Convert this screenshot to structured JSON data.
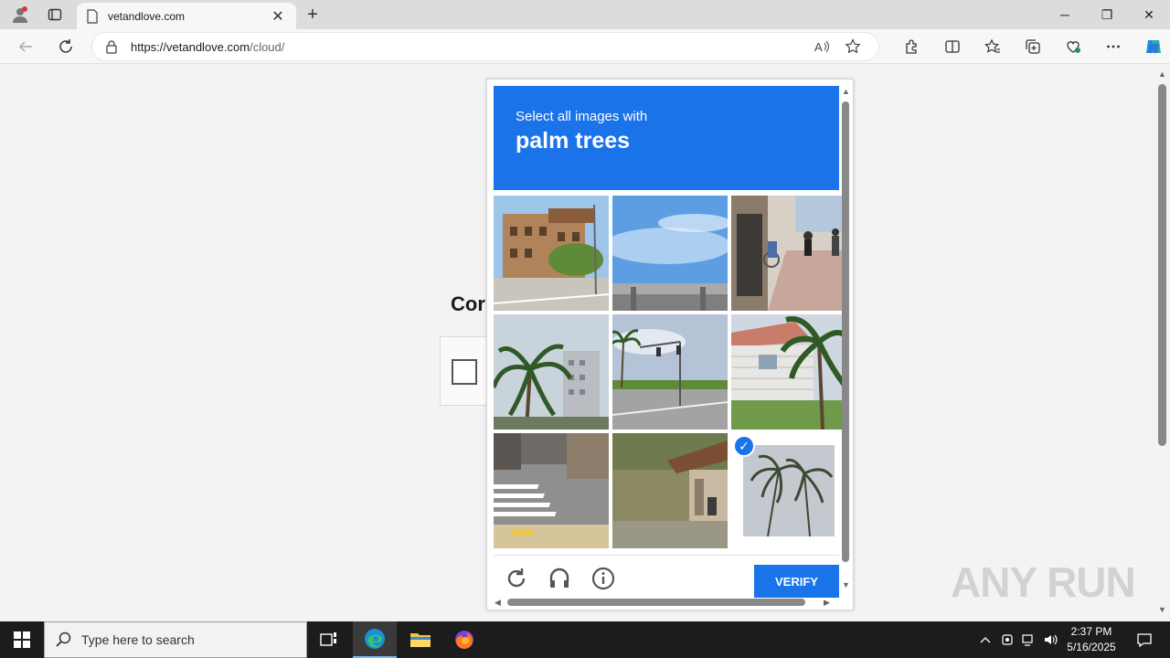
{
  "browser": {
    "tab_title": "vetandlove.com",
    "url_host": "https://vetandlove.com",
    "url_path": "/cloud/"
  },
  "page": {
    "heading_partial": "Cor"
  },
  "challenge": {
    "prompt_line1": "Select all images with",
    "prompt_line2": "palm trees",
    "verify_label": "VERIFY",
    "selected_tiles": [
      8
    ],
    "tiles": [
      {
        "name": "tile-building-street"
      },
      {
        "name": "tile-sky-bridge"
      },
      {
        "name": "tile-sidewalk-cyclists"
      },
      {
        "name": "tile-palm-building"
      },
      {
        "name": "tile-intersection-palms"
      },
      {
        "name": "tile-house-palm"
      },
      {
        "name": "tile-crosswalk"
      },
      {
        "name": "tile-shed-field"
      },
      {
        "name": "tile-palm-trees-selected"
      }
    ]
  },
  "watermark": "ANY RUN",
  "taskbar": {
    "search_placeholder": "Type here to search",
    "time": "2:37 PM",
    "date": "5/16/2025"
  },
  "colors": {
    "accent": "#1a73e8"
  }
}
